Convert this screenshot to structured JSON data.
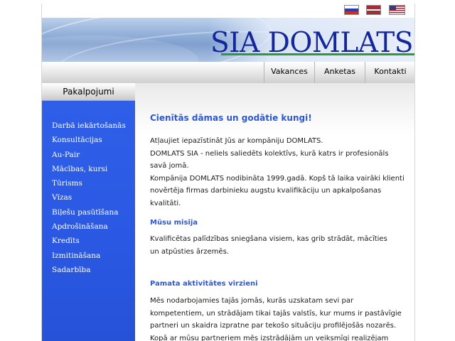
{
  "languages": [
    {
      "code": "ru",
      "flag": "russia-flag-icon"
    },
    {
      "code": "lv",
      "flag": "latvia-flag-icon"
    },
    {
      "code": "en",
      "flag": "usa-flag-icon"
    }
  ],
  "header": {
    "brand": "SIA DOMLATS",
    "brand_color": "#14279a",
    "accent_line_color": "#2d9a3a"
  },
  "topnav": {
    "items": [
      "Vakances",
      "Anketas",
      "Kontakti"
    ]
  },
  "sidebar": {
    "heading": "Pakalpojumi",
    "background_color": "#2a58e2",
    "items": [
      "Darbā iekārtošanās",
      "Konsultācijas",
      "Au-Pair",
      "Mācības, kursi",
      "Tūrisms",
      "Vīzas",
      "Biļešu pasūtīšana",
      "Apdrošināšana",
      "Kredīts",
      "Izmitināšana",
      "Sadarbība"
    ]
  },
  "content": {
    "title": "Cienītās dāmas un godātie kungi!",
    "intro_lines": [
      "Atļaujiet iepazīstināt Jūs ar kompāniju DOMLATS.",
      "DOMLATS SIA - neliels saliedēts kolektīvs, kurā katrs ir profesionāls savā jomā.",
      "Kompānija DOMLATS nodibināta 1999.gadā. Kopš tā laika vairāki klienti novērtēja firmas darbinieku augstu kvalifikāciju un apkalpošanas kvalitāti."
    ],
    "mission_heading": "Mūsu misija",
    "mission_text": "Kvalificētas palīdzības sniegšana visiem, kas grib strādāt, mācīties un atpūsties ārzemēs.",
    "activities_heading": "Pamata aktivitātes virzieni",
    "activities_lines": [
      "Mēs nodarbojamies tajās jomās, kurās uzskatam sevi par kompetentiem, un strādājam tikai tajās valstīs, kur mums ir pastāvīgie partneri un skaidra izpratne par tekošo situāciju profilējošās nozarēs.",
      "Kopā ar mūsu partneriem mēs izstrādājām un veiksmīgi realizējam"
    ],
    "accent_color": "#2a58d8"
  }
}
